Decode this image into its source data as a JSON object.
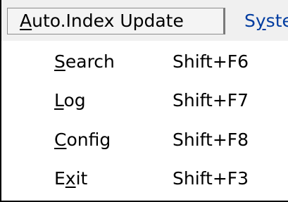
{
  "menubar": {
    "items": [
      {
        "label": "Auto.Index Update",
        "mnemonic_index": 0,
        "active": true
      },
      {
        "label": "Syste",
        "mnemonic_index": 1,
        "active": false
      }
    ]
  },
  "menu": {
    "items": [
      {
        "label": "Search",
        "mnemonic_index": 0,
        "shortcut": "Shift+F6"
      },
      {
        "label": "Log",
        "mnemonic_index": 0,
        "shortcut": "Shift+F7"
      },
      {
        "label": "Config",
        "mnemonic_index": 0,
        "shortcut": "Shift+F8"
      },
      {
        "label": "Exit",
        "mnemonic_index": 1,
        "shortcut": "Shift+F3"
      }
    ]
  }
}
